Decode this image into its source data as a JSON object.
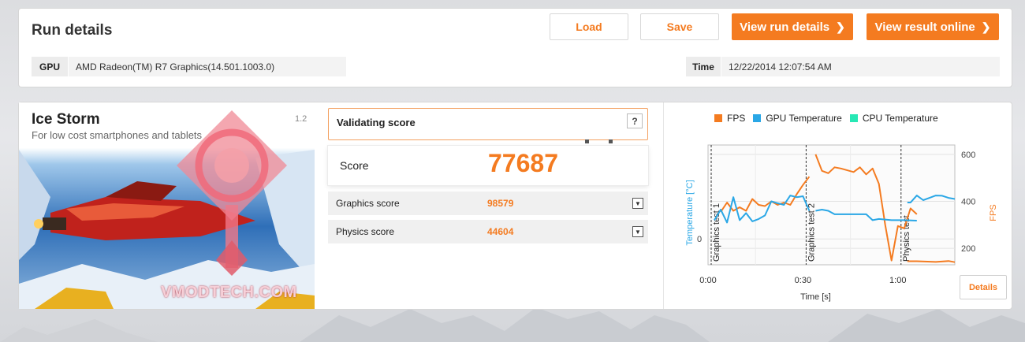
{
  "top": {
    "title": "Run details",
    "buttons": {
      "load": "Load",
      "save": "Save",
      "view_run": "View run details",
      "view_online": "View result online"
    },
    "gpu_label": "GPU",
    "gpu_value": "AMD Radeon(TM) R7 Graphics(14.501.1003.0)",
    "time_label": "Time",
    "time_value": "12/22/2014 12:07:54 AM"
  },
  "benchmark": {
    "name": "Ice Storm",
    "description": "For low cost smartphones and tablets",
    "version": "1.2",
    "watermark": "VMODTECH.COM"
  },
  "scores": {
    "validating": "Validating score",
    "help": "?",
    "score_label": "Score",
    "score_value": "77687",
    "graphics_label": "Graphics score",
    "graphics_value": "98579",
    "physics_label": "Physics score",
    "physics_value": "44604"
  },
  "chart_data": {
    "type": "line",
    "legend": [
      {
        "name": "FPS",
        "color": "#f47b20"
      },
      {
        "name": "GPU Temperature",
        "color": "#2aa7e6"
      },
      {
        "name": "CPU Temperature",
        "color": "#27e8b5"
      }
    ],
    "xlabel": "Time [s]",
    "ylabel_left": "Temperature [°C]",
    "ylabel_right": "FPS",
    "x_ticks": [
      "0:00",
      "0:30",
      "1:00"
    ],
    "y_left_ticks": [
      "0"
    ],
    "y_right_ticks": [
      "600",
      "400",
      "200"
    ],
    "xlim": [
      0,
      78
    ],
    "y_right_lim": [
      130,
      640
    ],
    "annotations": [
      {
        "x": 1,
        "label": "Graphics test 1"
      },
      {
        "x": 31,
        "label": "Graphics test 2"
      },
      {
        "x": 61,
        "label": "Physics test"
      }
    ],
    "series": [
      {
        "name": "FPS",
        "color": "#f47b20",
        "segments": [
          [
            [
              4,
              355
            ],
            [
              6,
              395
            ],
            [
              8,
              360
            ],
            [
              10,
              375
            ],
            [
              12,
              360
            ],
            [
              14,
              410
            ],
            [
              16,
              385
            ],
            [
              18,
              380
            ],
            [
              20,
              400
            ],
            [
              22,
              385
            ],
            [
              24,
              395
            ],
            [
              26,
              385
            ],
            [
              28,
              430
            ],
            [
              30,
              470
            ],
            [
              32,
              505
            ]
          ],
          [
            [
              34,
              600
            ],
            [
              36,
              530
            ],
            [
              38,
              520
            ],
            [
              40,
              545
            ],
            [
              42,
              540
            ],
            [
              46,
              525
            ],
            [
              48,
              545
            ],
            [
              50,
              515
            ],
            [
              52,
              540
            ],
            [
              54,
              475
            ],
            [
              56,
              300
            ],
            [
              58,
              148
            ],
            [
              60,
              295
            ],
            [
              62,
              285
            ],
            [
              64,
              370
            ],
            [
              66,
              345
            ]
          ],
          [
            [
              63,
              145
            ],
            [
              66,
              145
            ],
            [
              72,
              142
            ],
            [
              76,
              146
            ],
            [
              78,
              141
            ]
          ]
        ]
      },
      {
        "name": "GPU Temperature",
        "color": "#2aa7e6",
        "segments": [
          [
            [
              2,
              320
            ],
            [
              4,
              365
            ],
            [
              6,
              310
            ],
            [
              8,
              418
            ],
            [
              10,
              320
            ],
            [
              12,
              350
            ],
            [
              14,
              315
            ],
            [
              16,
              325
            ],
            [
              18,
              340
            ],
            [
              20,
              400
            ],
            [
              22,
              392
            ],
            [
              24,
              385
            ],
            [
              26,
              425
            ],
            [
              28,
              418
            ],
            [
              30,
              422
            ],
            [
              32,
              360
            ]
          ],
          [
            [
              34,
              360
            ],
            [
              36,
              365
            ],
            [
              38,
              360
            ],
            [
              40,
              345
            ],
            [
              44,
              345
            ],
            [
              48,
              345
            ],
            [
              50,
              345
            ],
            [
              52,
              320
            ],
            [
              54,
              325
            ],
            [
              58,
              320
            ],
            [
              62,
              320
            ],
            [
              66,
              318
            ]
          ],
          [
            [
              63,
              395
            ],
            [
              64,
              395
            ],
            [
              66,
              425
            ],
            [
              68,
              405
            ],
            [
              70,
              415
            ],
            [
              72,
              425
            ],
            [
              74,
              424
            ],
            [
              76,
              415
            ],
            [
              78,
              410
            ]
          ]
        ]
      }
    ]
  }
}
